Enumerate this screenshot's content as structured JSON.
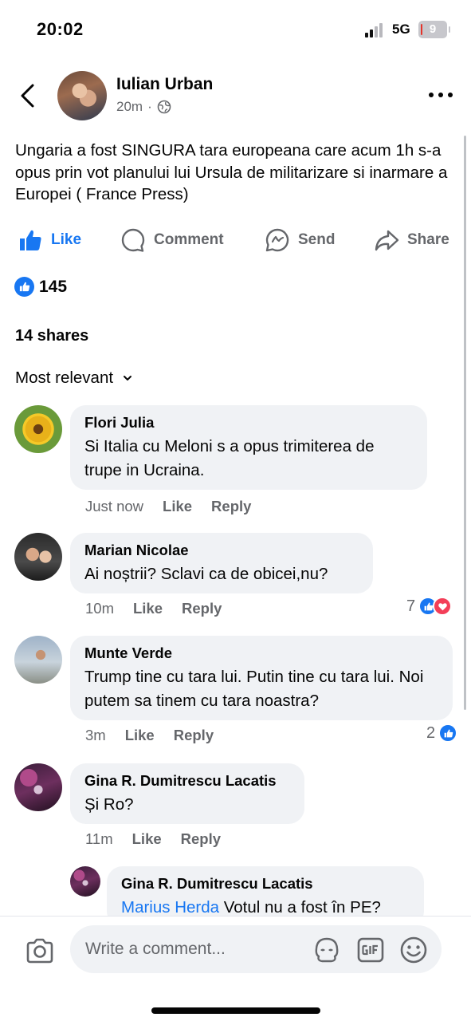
{
  "status_bar": {
    "time": "20:02",
    "network": "5G",
    "battery": "9"
  },
  "post": {
    "author": "Iulian Urban",
    "time": "20m",
    "separator": "·",
    "text": "Ungaria a fost SINGURA tara europeana care acum 1h s-a opus prin vot planului lui Ursula de militarizare si inarmare a Europei ( France Press)",
    "actions": {
      "like": "Like",
      "comment": "Comment",
      "send": "Send",
      "share": "Share"
    },
    "reaction_count": "145",
    "shares": "14 shares",
    "sort": "Most relevant"
  },
  "comments": [
    {
      "name": "Flori Julia",
      "text": "Si Italia cu Meloni s a opus trimiterea de trupe in Ucraina.",
      "time": "Just now",
      "like": "Like",
      "reply": "Reply",
      "reactions": ""
    },
    {
      "name": "Marian Nicolae",
      "text": "Ai noștrii? Sclavi ca de obicei,nu?",
      "time": "10m",
      "like": "Like",
      "reply": "Reply",
      "reactions": "7"
    },
    {
      "name": "Munte Verde",
      "text": "Trump tine cu tara lui. Putin tine cu tara lui. Noi putem sa tinem cu tara noastra?",
      "time": "3m",
      "like": "Like",
      "reply": "Reply",
      "reactions": "2"
    },
    {
      "name": "Gina R. Dumitrescu Lacatis",
      "text": "Și Ro?",
      "time": "11m",
      "like": "Like",
      "reply": "Reply",
      "reactions": ""
    }
  ],
  "reply": {
    "name": "Gina R. Dumitrescu Lacatis",
    "mention": "Marius Herda",
    "text": " Votul nu a fost în PE?"
  },
  "composer": {
    "placeholder": "Write a comment..."
  },
  "colors": {
    "accent": "#1877f2",
    "love": "#f33e58",
    "bubble": "#f0f2f5",
    "muted": "#65676b"
  }
}
